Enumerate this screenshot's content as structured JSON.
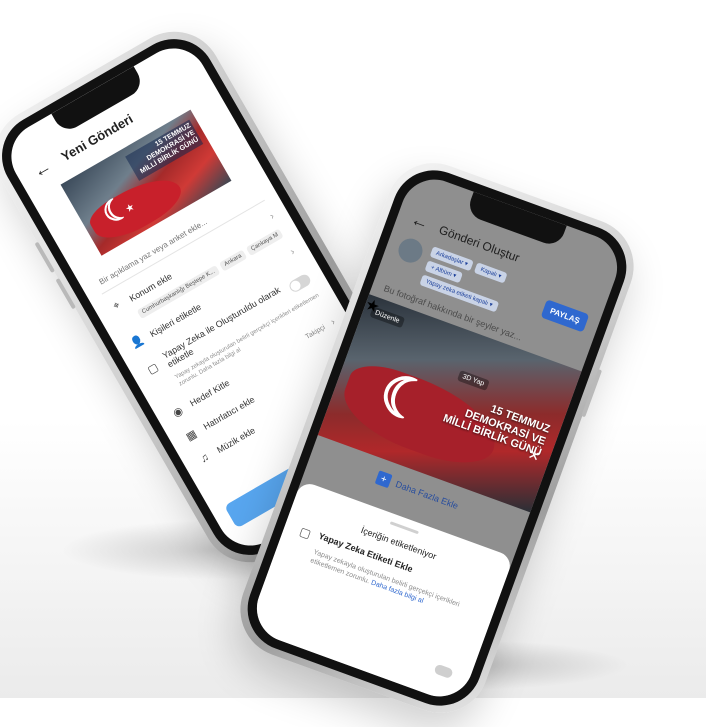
{
  "left_phone": {
    "back_icon": "arrow-left-icon",
    "title": "Yeni Gönderi",
    "banner_text": "15 TEMMUZ DEMOKRASİ VE MİLLİ BİRLİK GÜNÜ",
    "caption_placeholder": "Bir açıklama yaz veya anket ekle...",
    "location_label": "Konum ekle",
    "location_chips": [
      "Cumhurbaşkanlığı Beştepe K...",
      "Ankara",
      "Çankaya M"
    ],
    "tag_people_label": "Kişileri etiketle",
    "ai_label_title": "Yapay Zeka ile Oluşturuldu olarak etiketle",
    "ai_label_desc": "Yapay zekayla oluşturulan belirli gerçekçi içerikleri etiketlemen zorunlu. Daha fazla bilgi al",
    "audience_label": "Hedef Kitle",
    "audience_value": "Takipçi",
    "reminder_label": "Hatırlatıcı ekle",
    "music_label": "Müzik ekle",
    "share_button": "Paylaş"
  },
  "right_phone": {
    "back_icon": "arrow-left-icon",
    "title": "Gönderi Oluştur",
    "pills": [
      "Arkadaşlar ▾",
      "Kapalı ▾",
      "+ Albüm ▾",
      "Yapay zeka etiketi kapalı ▾"
    ],
    "share_button": "PAYLAŞ",
    "placeholder": "Bu fotoğraf hakkında bir şeyler yaz...",
    "image_tags": [
      "Düzenle",
      "3D Yap"
    ],
    "banner_text": "15 TEMMUZ DEMOKRASİ VE MİLLİ BİRLİK GÜNÜ",
    "add_more": "Daha Fazla Ekle",
    "sheet_title": "İçeriğin etiketleniyor",
    "sheet_option": "Yapay Zeka Etiketi Ekle",
    "sheet_desc": "Yapay zekayla oluşturulan belirli gerçekçi içerikleri etiketlemen zorunlu.",
    "sheet_link": "Daha fazla bilgi al"
  }
}
